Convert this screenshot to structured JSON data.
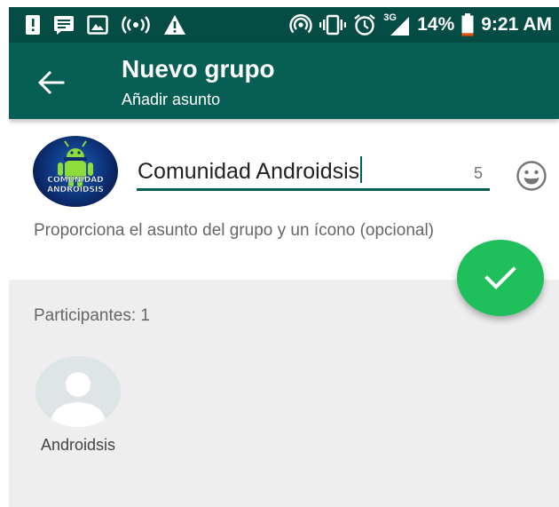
{
  "status_bar": {
    "battery": "14%",
    "time": "9:21 AM",
    "network": "3G",
    "left_icons": [
      "notification-alert-icon",
      "message-icon",
      "image-icon",
      "broadcast-icon",
      "warning-icon"
    ],
    "right_icons": [
      "hotspot-icon",
      "vibrate-icon",
      "alarm-icon",
      "signal-3g-icon",
      "battery-icon"
    ],
    "battery_level": 0.14,
    "battery_color": "#e65100"
  },
  "toolbar": {
    "title": "Nuevo grupo",
    "subtitle": "Añadir asunto",
    "color": "#075e54",
    "back_icon": "arrow-left-icon"
  },
  "subject": {
    "value": "Comunidad Androidsis",
    "remaining": "5",
    "hint": "Proporciona el asunto del grupo y un ícono (opcional)",
    "avatar_text": [
      "COMUNIDAD",
      "ANDROIDSIS"
    ],
    "emoji_icon": "smiley-icon"
  },
  "participants": {
    "label": "Participantes: 1",
    "items": [
      {
        "name": "Androidsis",
        "icon": "default-avatar-icon"
      }
    ]
  },
  "fab": {
    "icon": "check-icon",
    "color": "#1fbf5c"
  }
}
